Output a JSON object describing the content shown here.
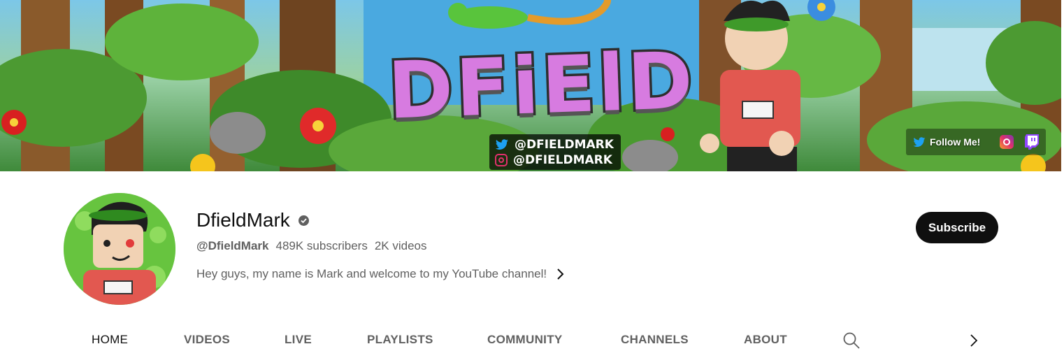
{
  "banner": {
    "title": "DFiElD",
    "twitter_handle": "@DFIELDMARK",
    "instagram_handle": "@DFIELDMARK",
    "links": {
      "follow_label": "Follow Me!"
    }
  },
  "channel": {
    "name": "DfieldMark",
    "handle": "@DfieldMark",
    "subscribers": "489K subscribers",
    "videos": "2K videos",
    "description": "Hey guys, my name is Mark and welcome to my YouTube channel!",
    "subscribe_label": "Subscribe"
  },
  "tabs": [
    {
      "label": "HOME"
    },
    {
      "label": "VIDEOS"
    },
    {
      "label": "LIVE"
    },
    {
      "label": "PLAYLISTS"
    },
    {
      "label": "COMMUNITY"
    },
    {
      "label": "CHANNELS"
    },
    {
      "label": "ABOUT"
    }
  ],
  "icons": {
    "verified": "verified-check-icon",
    "search": "search-icon",
    "next": "chevron-right-icon",
    "twitter": "twitter-icon",
    "instagram": "instagram-icon",
    "twitch": "twitch-icon"
  },
  "colors": {
    "subscribe_bg": "#0f0f0f",
    "text_primary": "#0f0f0f",
    "text_secondary": "#606060",
    "banner_title": "#d77be0"
  }
}
